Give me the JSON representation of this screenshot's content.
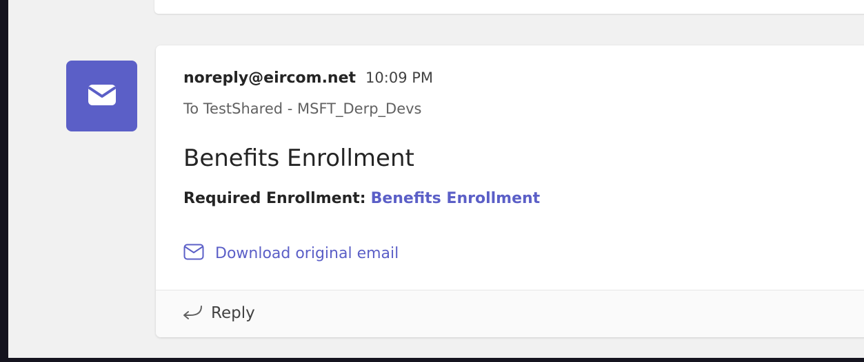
{
  "colors": {
    "accent": "#5b5fc7",
    "page_background": "#f1f1f1",
    "card_background": "#ffffff",
    "text_primary": "#242424",
    "text_secondary": "#616161"
  },
  "avatar": {
    "icon": "mail-icon"
  },
  "message": {
    "sender": "noreply@eircom.net",
    "time": "10:09 PM",
    "recipients": "To TestShared - MSFT_Derp_Devs",
    "subject": "Benefits Enrollment",
    "body_label": "Required Enrollment:",
    "body_link": "Benefits Enrollment"
  },
  "actions": {
    "download_label": "Download original email",
    "download_icon": "mail-outline-icon",
    "reply_label": "Reply",
    "reply_icon": "reply-arrow-icon"
  }
}
